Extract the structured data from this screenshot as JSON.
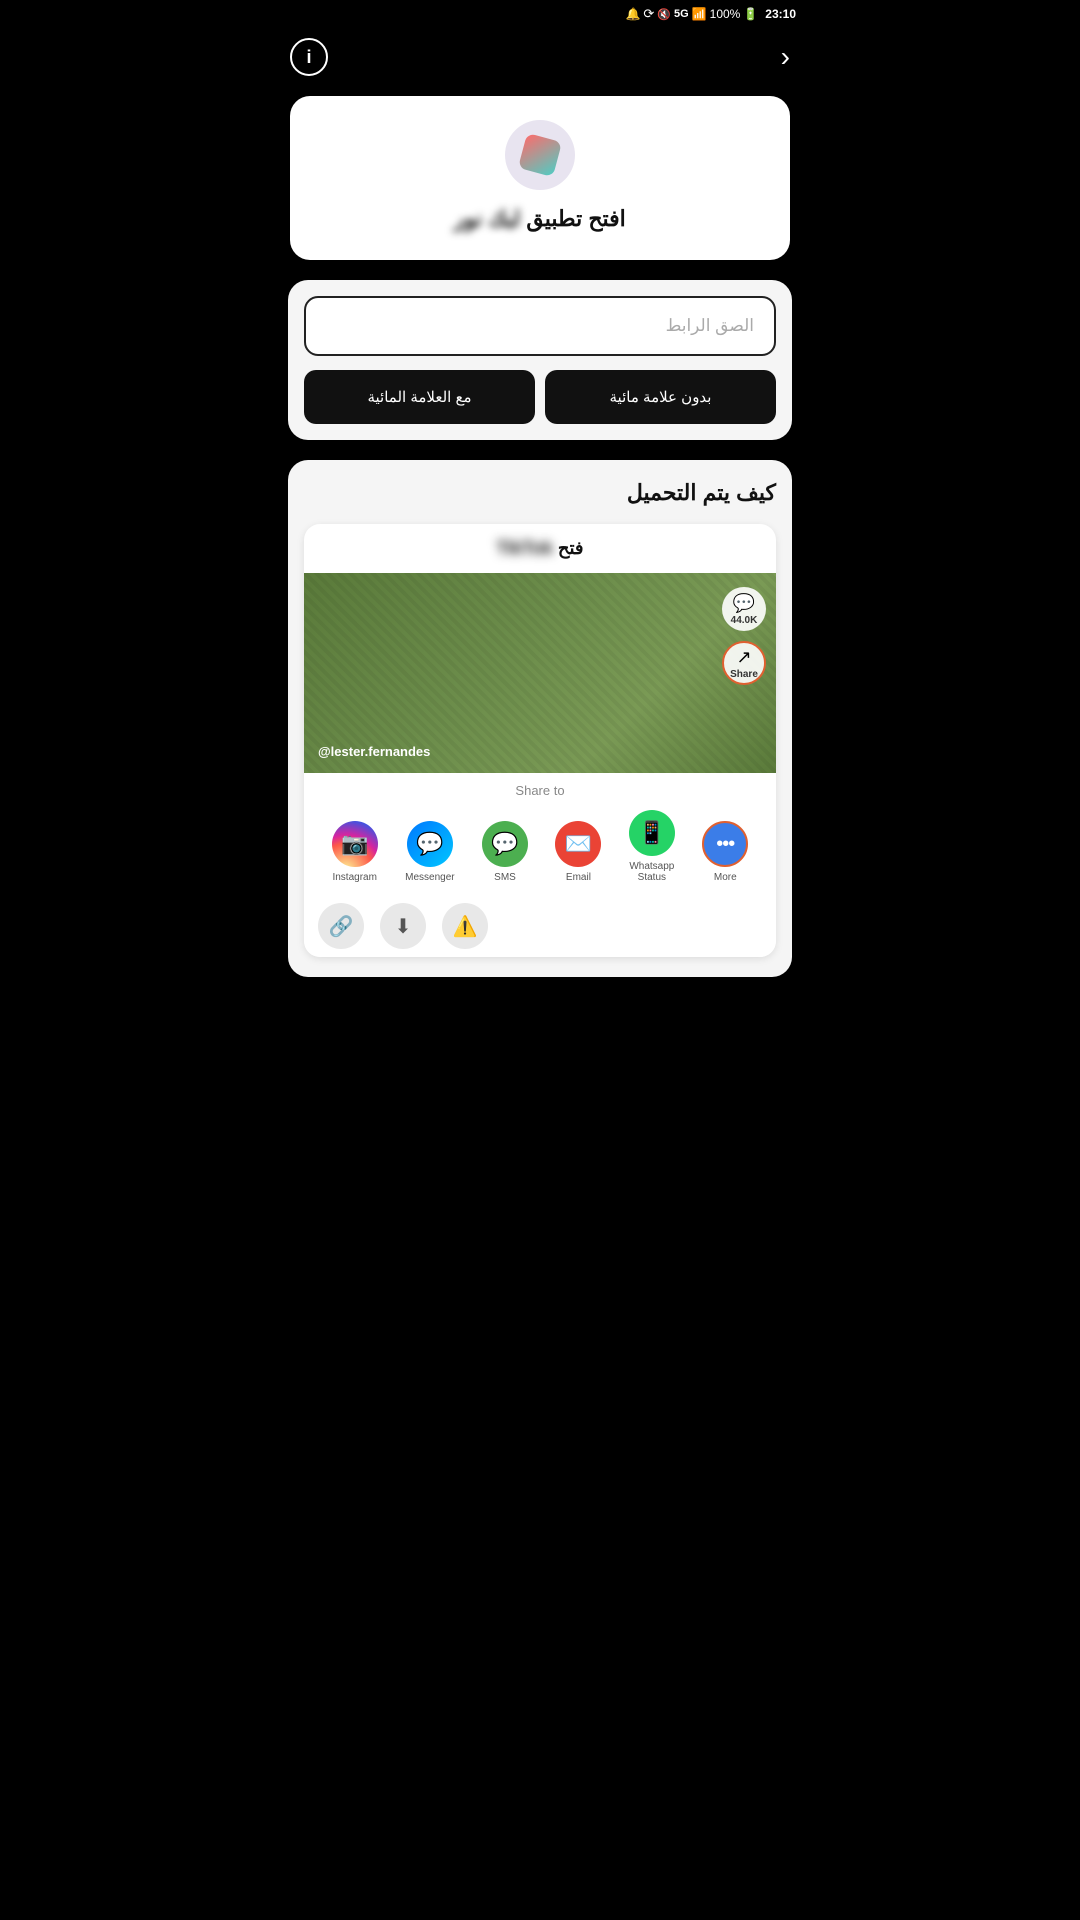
{
  "statusBar": {
    "time": "23:10",
    "battery": "100%",
    "signal": "5G"
  },
  "nav": {
    "infoLabel": "i",
    "arrowLabel": "›"
  },
  "appCard": {
    "openAppText": "افتح تطبيق",
    "appNameBlurred": "لبك نور"
  },
  "downloadCard": {
    "inputPlaceholder": "الصق الرابط",
    "withWatermarkBtn": "مع العلامة المائية",
    "withoutWatermarkBtn": "بدون علامة مائية"
  },
  "howSection": {
    "title": "كيف يتم التحميل",
    "openTikTokText": "فتح",
    "tiktokBrand": "TikTok",
    "username": "@lester.fernandes",
    "commentCount": "44.0K",
    "shareLabel": "Share",
    "shareToTitle": "Share to",
    "shareApps": [
      {
        "name": "Instagram",
        "label": "Instagram"
      },
      {
        "name": "Messenger",
        "label": "Messenger"
      },
      {
        "name": "SMS",
        "label": "SMS"
      },
      {
        "name": "Email",
        "label": "Email"
      },
      {
        "name": "WhatsApp Status",
        "label": "Whatsapp\nStatus"
      },
      {
        "name": "More",
        "label": "More"
      }
    ]
  }
}
